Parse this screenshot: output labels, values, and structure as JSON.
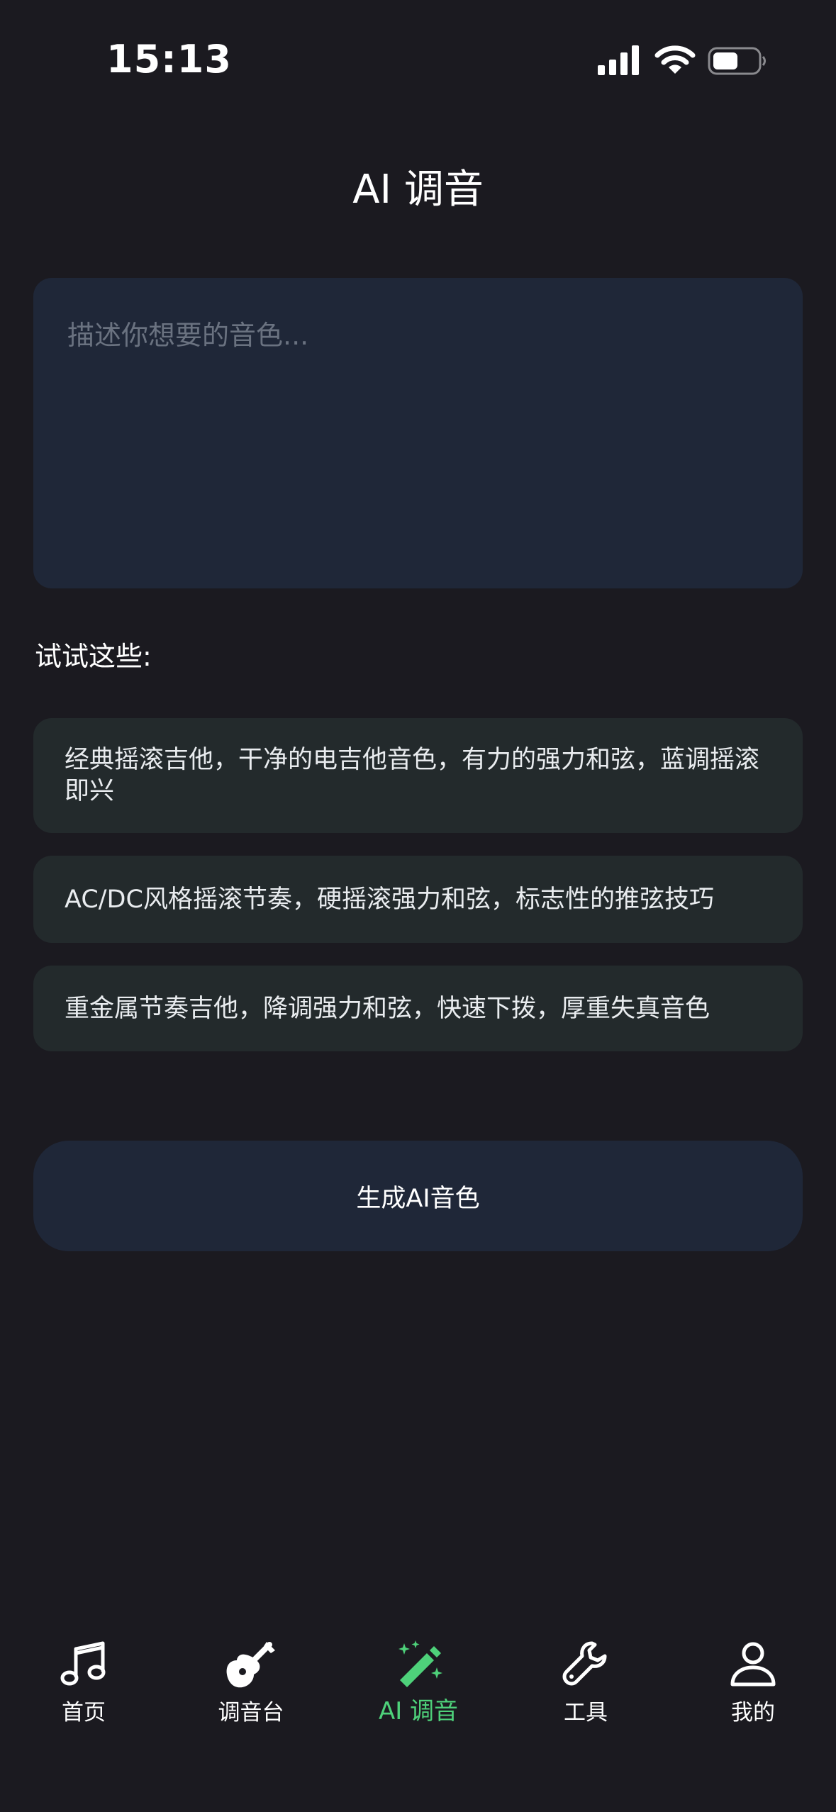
{
  "status_bar": {
    "time": "15:13"
  },
  "page": {
    "title": "AI 调音"
  },
  "input": {
    "placeholder": "描述你想要的音色..."
  },
  "suggestions": {
    "title": "试试这些:",
    "items": [
      "经典摇滚吉他，干净的电吉他音色，有力的强力和弦，蓝调摇滚即兴",
      "AC/DC风格摇滚节奏，硬摇滚强力和弦，标志性的推弦技巧",
      "重金属节奏吉他，降调强力和弦，快速下拨，厚重失真音色"
    ]
  },
  "generate_button": {
    "label": "生成AI音色"
  },
  "tab_bar": {
    "items": [
      {
        "label": "首页",
        "icon": "music-note-icon"
      },
      {
        "label": "调音台",
        "icon": "guitar-icon"
      },
      {
        "label": "AI 调音",
        "icon": "magic-wand-icon"
      },
      {
        "label": "工具",
        "icon": "wrench-icon"
      },
      {
        "label": "我的",
        "icon": "person-icon"
      }
    ],
    "active_index": 2
  },
  "colors": {
    "background": "#1b1a20",
    "input_bg": "#1f2738",
    "suggestion_bg": "#232a2c",
    "accent": "#4ed17a"
  }
}
